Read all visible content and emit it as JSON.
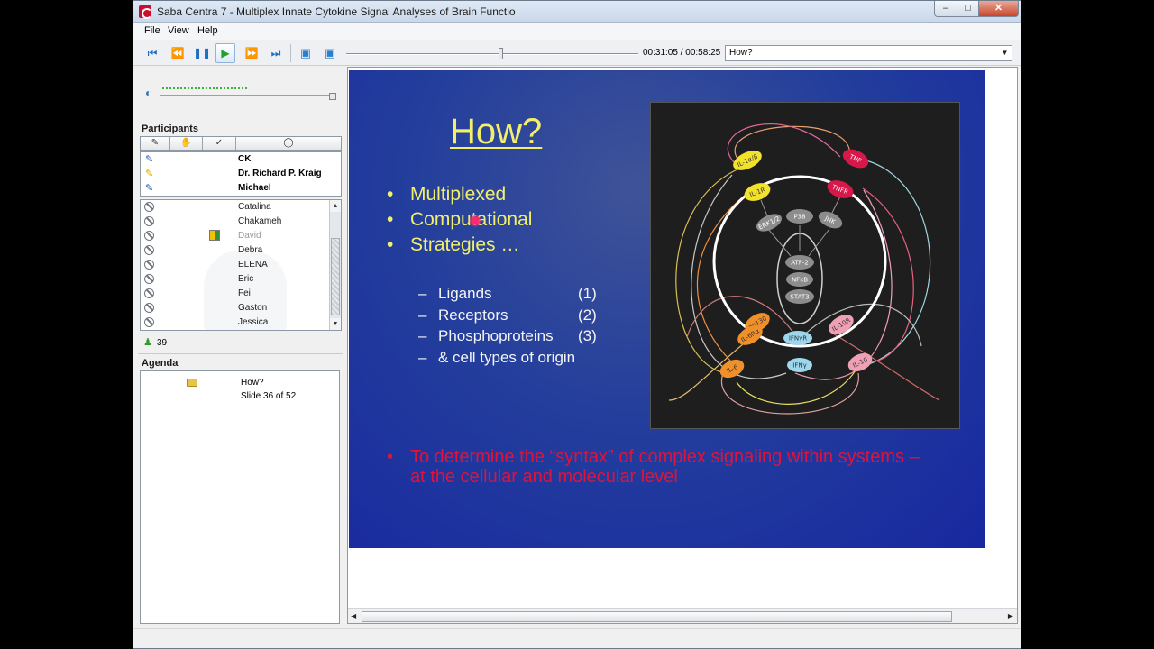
{
  "window": {
    "title": "Saba Centra 7 - Multiplex Innate Cytokine Signal Analyses of Brain Functio"
  },
  "menu": {
    "file": "File",
    "view": "View",
    "help": "Help"
  },
  "toolbar": {
    "time": "00:31:05 / 00:58:25",
    "slide_selector_value": "How?"
  },
  "participants": {
    "label": "Participants",
    "presenters": [
      "CK",
      "Dr. Richard P. Kraig",
      "Michael"
    ],
    "attendees": [
      {
        "name": "Catalina",
        "dimmed": false
      },
      {
        "name": "Chakameh",
        "dimmed": false
      },
      {
        "name": "David",
        "dimmed": true
      },
      {
        "name": "Debra",
        "dimmed": false
      },
      {
        "name": "ELENA",
        "dimmed": false
      },
      {
        "name": "Eric",
        "dimmed": false
      },
      {
        "name": "Fei",
        "dimmed": false
      },
      {
        "name": "Gaston",
        "dimmed": false
      },
      {
        "name": "Jessica",
        "dimmed": false
      }
    ],
    "count": "39"
  },
  "agenda": {
    "label": "Agenda",
    "item_title": "How?",
    "item_sub": "Slide 36 of 52"
  },
  "slide": {
    "title": "How?",
    "bullets": [
      "Multiplexed",
      "Computational",
      "Strategies …"
    ],
    "sub_bullets": [
      {
        "text": "Ligands",
        "num": "(1)"
      },
      {
        "text": "Receptors",
        "num": "(2)"
      },
      {
        "text": "Phosphoproteins",
        "num": "(3)"
      },
      {
        "text": "& cell types of origin",
        "num": ""
      }
    ],
    "goal": "To determine the “syntax” of complex signaling within systems – at the cellular and molecular level"
  },
  "diagram": {
    "nodes": {
      "il1ab": "IL-1α/β",
      "tnf": "TNF",
      "il1r": "IL-1R",
      "tnfr": "TNFR",
      "erk": "ERK1/2",
      "p38": "P38",
      "jnk": "JNK",
      "atf2": "ATF-2",
      "nfkb": "NFkB",
      "stat3": "STAT3",
      "gp130": "gp130",
      "il6ra": "IL-6Rα",
      "ifngr": "IFNγR",
      "il10r": "IL-10R",
      "il6": "IL-6",
      "ifng": "IFNγ",
      "il10": "IL-10"
    }
  },
  "colors": {
    "slide_text": "#f2f06a",
    "goal_text": "#e0133a",
    "accent": "#1d6fc1"
  },
  "icons": {
    "first": "skip-first-icon",
    "rewind": "rewind-icon",
    "pause": "pause-icon",
    "play": "play-icon",
    "forward": "fast-forward-icon",
    "last": "skip-last-icon"
  }
}
